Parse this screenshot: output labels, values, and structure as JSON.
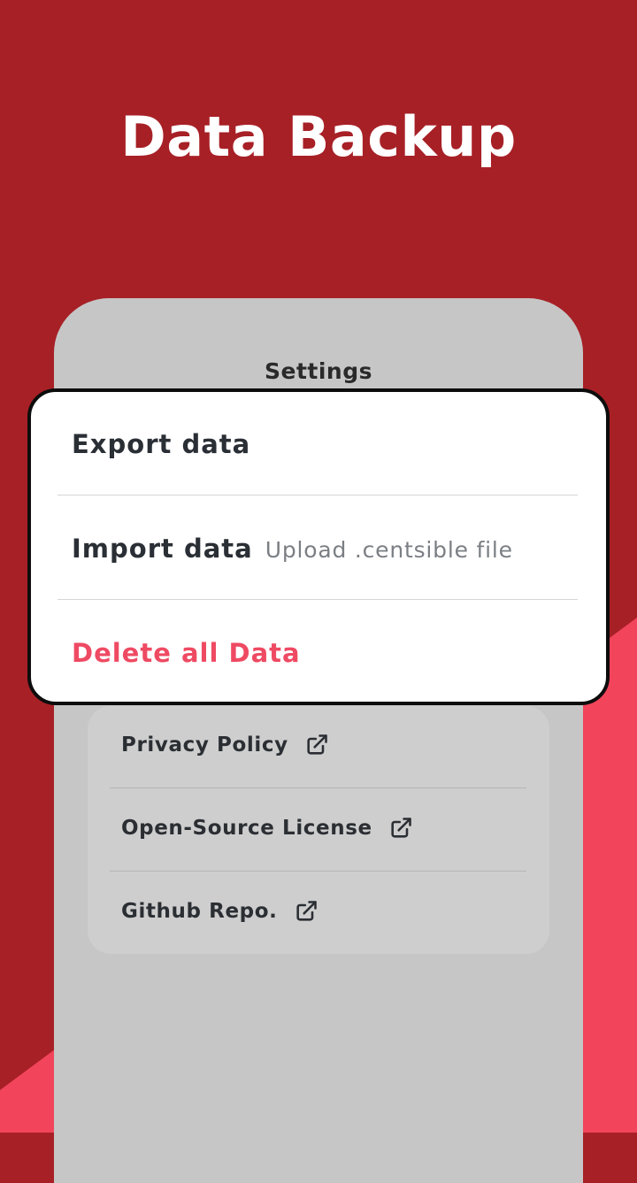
{
  "hero": {
    "title": "Data Backup"
  },
  "screen": {
    "title": "Settings"
  },
  "dialog": {
    "export_label": "Export data",
    "import_label": "Import data",
    "import_hint": "Upload .centsible file",
    "delete_label": "Delete all Data"
  },
  "links": {
    "items": [
      {
        "label": "Privacy Policy",
        "icon": "external-link-icon"
      },
      {
        "label": "Open-Source License",
        "icon": "external-link-icon"
      },
      {
        "label": "Github Repo.",
        "icon": "external-link-icon"
      }
    ]
  },
  "colors": {
    "background": "#a72026",
    "accent": "#f2455c",
    "danger_text": "#ef4a63",
    "phone_bg": "#c6c6c6",
    "card_bg": "#cecece"
  }
}
